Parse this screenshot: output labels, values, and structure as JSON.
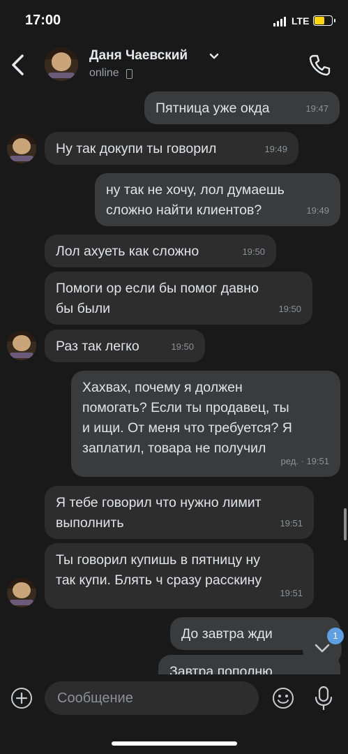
{
  "status_bar": {
    "time": "17:00",
    "network": "LTE"
  },
  "header": {
    "contact_name": "Даня Чаевский",
    "status": "online",
    "icons": {
      "back": "chevron-left-icon",
      "call": "phone-icon",
      "dropdown": "chevron-down-icon"
    }
  },
  "messages": [
    {
      "dir": "out",
      "text": "Пятница уже окда",
      "time": "19:47"
    },
    {
      "dir": "in",
      "text": "Ну так докупи ты говорил",
      "time": "19:49"
    },
    {
      "dir": "out",
      "text": "ну так не хочу, лол думаешь\nсложно найти клиентов?",
      "time": "19:49"
    },
    {
      "dir": "in",
      "text": "Лол ахуеть как сложно",
      "time": "19:50"
    },
    {
      "dir": "in",
      "text": "Помоги ор если бы помог давно\nбы были",
      "time": "19:50"
    },
    {
      "dir": "in",
      "text": "Раз так легко",
      "time": "19:50"
    },
    {
      "dir": "out",
      "text": "Хахвах, почему я должен\nпомогать? Если ты продавец, ты\nи ищи. От меня что требуется? Я\nзаплатил, товара не получил",
      "time": "ред. · 19:51"
    },
    {
      "dir": "in",
      "text": "Я тебе говорил что нужно лимит\nвыполнить",
      "time": "19:51"
    },
    {
      "dir": "in",
      "text": "Ты говорил купишь в пятницу ну\nтак купи. Блять ч сразу расскину",
      "time": "19:51"
    },
    {
      "dir": "out",
      "text": "До завтра жди",
      "time": ""
    },
    {
      "dir": "out",
      "text": "Завтра пополню",
      "time": ""
    }
  ],
  "scroll_down_badge": "1",
  "composer": {
    "placeholder": "Сообщение"
  },
  "colors": {
    "background": "#19191a",
    "incoming": "#2d2d2e",
    "outgoing": "#3a3b3d",
    "accent": "#5f9fe3"
  }
}
